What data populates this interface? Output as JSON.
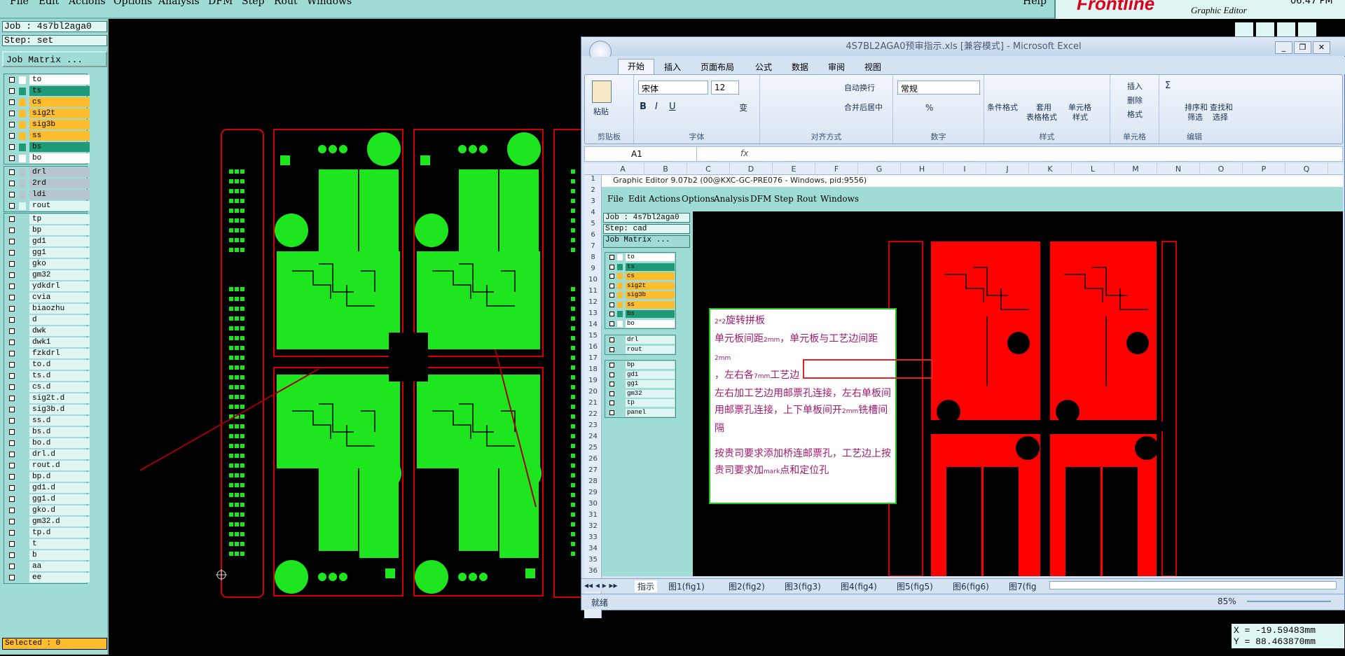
{
  "menu": [
    "File",
    "Edit",
    "Actions",
    "Options",
    "Analysis",
    "DFM",
    "Step",
    "Rout",
    "Windows"
  ],
  "help_label": "Help",
  "brand": {
    "logo": "Frontline",
    "subtitle": "Graphic Editor",
    "clock": "06:47 PM"
  },
  "job": "Job : 4s7bl2aga0",
  "step": "Step: set",
  "job_matrix": "Job Matrix ...",
  "board_layers": [
    {
      "name": "to",
      "color": "#ffffff"
    },
    {
      "name": "ts",
      "color": "#1f9a76"
    },
    {
      "name": "cs",
      "color": "#ffbd2e"
    },
    {
      "name": "sig2t",
      "color": "#ffbd2e"
    },
    {
      "name": "sig3b",
      "color": "#ffbd2e"
    },
    {
      "name": "ss",
      "color": "#ffbd2e"
    },
    {
      "name": "bs",
      "color": "#1f9a76"
    },
    {
      "name": "bo",
      "color": "#ffffff"
    }
  ],
  "drill_layers": [
    {
      "name": "drl",
      "color": "#b7c6cc"
    },
    {
      "name": "2rd",
      "color": "#b7c6cc"
    },
    {
      "name": "ldi",
      "color": "#b7c6cc"
    },
    {
      "name": "rout",
      "color": "#dff6f4"
    }
  ],
  "misc_layers": [
    "tp",
    "bp",
    "gd1",
    "gg1",
    "gko",
    "gm32",
    "ydkdrl",
    "cvia",
    "biaozhu",
    "d",
    "dwk",
    "dwk1",
    "fzkdrl",
    "to.d",
    "ts.d",
    "cs.d",
    "sig2t.d",
    "sig3b.d",
    "ss.d",
    "bs.d",
    "bo.d",
    "drl.d",
    "rout.d",
    "bp.d",
    "gd1.d",
    "gg1.d",
    "gko.d",
    "gm32.d",
    "tp.d",
    "t",
    "b",
    "aa",
    "ee"
  ],
  "selected": "Selected : 0",
  "coords": {
    "x": "X = -19.59483mm",
    "y": "Y = 88.463870mm"
  },
  "excel": {
    "title": "4S7BL2AGA0预审指示.xls [兼容模式] - Microsoft Excel",
    "tabs": [
      "开始",
      "插入",
      "页面布局",
      "公式",
      "数据",
      "审阅",
      "视图"
    ],
    "clipboard": {
      "paste": "粘贴",
      "label": "剪贴板"
    },
    "font": {
      "name": "宋体",
      "size": "12",
      "label": "字体",
      "bold": "B",
      "italic": "I",
      "underline": "U",
      "wen": "变"
    },
    "align": {
      "wrap": "自动换行",
      "merge": "合并后居中",
      "label": "对齐方式"
    },
    "number": {
      "format": "常规",
      "percent": "%",
      "label": "数字"
    },
    "styles": {
      "cond": "条件格式",
      "table1": "套用",
      "table2": "表格格式",
      "cell1": "单元格",
      "cell2": "样式",
      "label": "样式"
    },
    "cells": {
      "insert": "插入",
      "delete": "删除",
      "format": "格式",
      "label": "单元格"
    },
    "edit": {
      "sum": "Σ",
      "sort1": "排序和",
      "sort2": "筛选",
      "find1": "查找和",
      "find2": "选择",
      "label": "编辑"
    },
    "namebox": "A1",
    "fx": "fx",
    "columns": [
      "A",
      "B",
      "C",
      "D",
      "E",
      "F",
      "G",
      "H",
      "I",
      "J",
      "K",
      "L",
      "M",
      "N",
      "O",
      "P",
      "Q"
    ],
    "inner_title": "Graphic Editor 9.07b2 (00@KXC-GC-PRE076 - Windows, pid:9556)",
    "inner_job": "Job : 4s7bl2aga0",
    "inner_step": "Step: cad",
    "inner_job_matrix": "Job Matrix ...",
    "inner_layers_a": [
      {
        "name": "to",
        "color": "#ffffff"
      },
      {
        "name": "ts",
        "color": "#1f9a76"
      },
      {
        "name": "cs",
        "color": "#ffbd2e"
      },
      {
        "name": "sig2t",
        "color": "#ffbd2e"
      },
      {
        "name": "sig3b",
        "color": "#ffbd2e"
      },
      {
        "name": "ss",
        "color": "#ffbd2e"
      },
      {
        "name": "bs",
        "color": "#1f9a76"
      },
      {
        "name": "bo",
        "color": "#ffffff"
      }
    ],
    "inner_layers_b": [
      "drl",
      "rout"
    ],
    "inner_layers_c": [
      "bp",
      "gd1",
      "gg1",
      "gm32",
      "tp",
      "panel"
    ],
    "note": {
      "line1_prefix": "2",
      "line1_small": "*2",
      "line1": "旋转拼板",
      "line2a": "单元板间距",
      "mm": "mm",
      "line2b": "，单元板与工艺边间距",
      "line3a": "，左右各",
      "n7": "7",
      "line3b": "工艺边",
      "line4": "左右加工艺边用邮票孔连接，左右单板间",
      "line5a": "用邮票孔连接，",
      "line5b": "上下单板间开",
      "n2": "2",
      "line5c": "铣槽间隔",
      "line6": "按贵司要求添加桥连邮票孔，工艺边上按",
      "line7a": "贵司要求加",
      "mark": "mark",
      "line7b": "点和定位孔"
    },
    "sheet_tabs": [
      "指示",
      "图1(fig1)",
      "图2(fig2)",
      "图3(fig3)",
      "图4(fig4)",
      "图5(fig5)",
      "图6(fig6)",
      "图7(fig"
    ],
    "status": "就绪",
    "zoom": "85%"
  },
  "colors": {
    "pcb_green": "#1ee61e",
    "pcb_red": "#ff0000",
    "outline": "#d40000",
    "panel_teal": "#9fdcd6"
  }
}
